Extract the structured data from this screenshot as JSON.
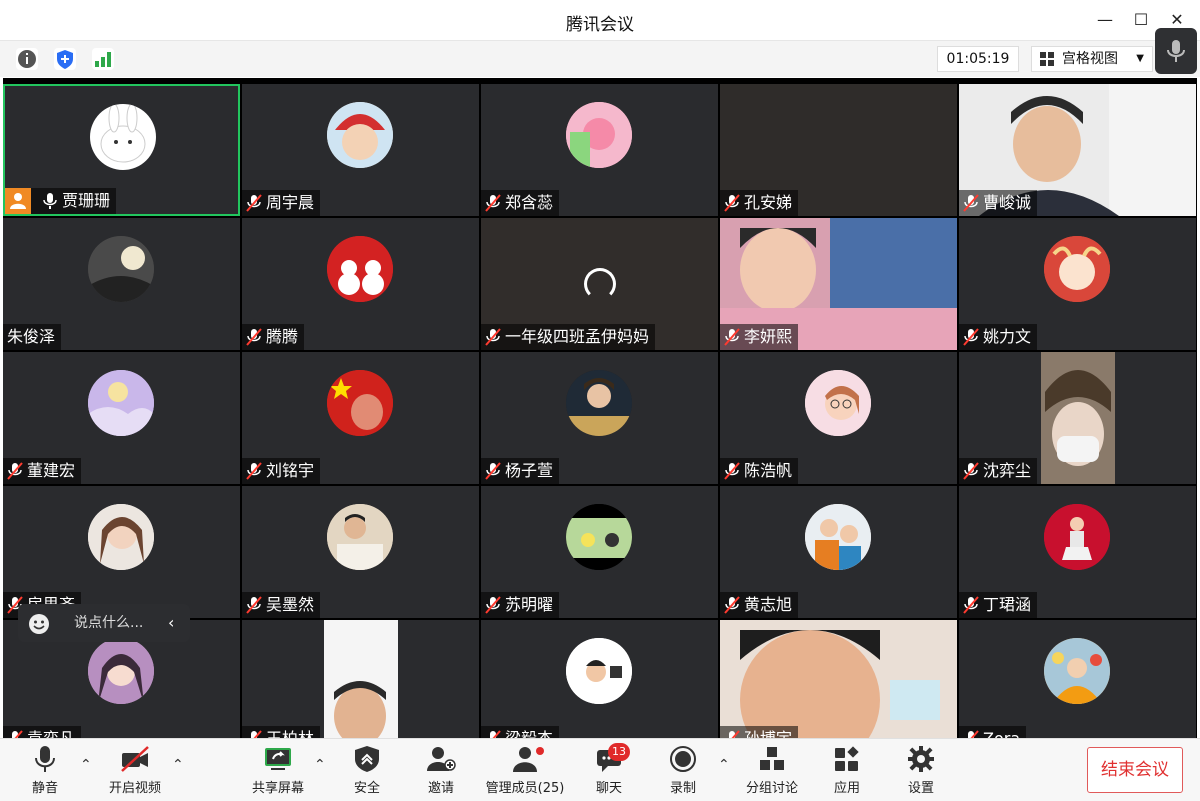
{
  "window": {
    "title": "腾讯会议"
  },
  "toolbar": {
    "timer": "01:05:19",
    "view_label": "宫格视图"
  },
  "tiles": [
    {
      "name": "贾珊珊"
    },
    {
      "name": "周宇晨"
    },
    {
      "name": "郑含蕊"
    },
    {
      "name": "孔安娣"
    },
    {
      "name": "曹峻诚"
    },
    {
      "name": "朱俊泽"
    },
    {
      "name": "腾腾"
    },
    {
      "name": "一年级四班孟伊妈妈"
    },
    {
      "name": "李妍熙"
    },
    {
      "name": "姚力文"
    },
    {
      "name": "董建宏"
    },
    {
      "name": "刘铭宇"
    },
    {
      "name": "杨子萱"
    },
    {
      "name": "陈浩帆"
    },
    {
      "name": "沈弈尘"
    },
    {
      "name": "房思齐"
    },
    {
      "name": "吴墨然"
    },
    {
      "name": "苏明曜"
    },
    {
      "name": "黄志旭"
    },
    {
      "name": "丁珺涵"
    },
    {
      "name": "袁奕凡"
    },
    {
      "name": "王柏林"
    },
    {
      "name": "梁毅杰"
    },
    {
      "name": "孙博宇"
    },
    {
      "name": "Zora"
    }
  ],
  "chat": {
    "placeholder": "说点什么..."
  },
  "bottom": {
    "mute": "静音",
    "video": "开启视频",
    "share": "共享屏幕",
    "security": "安全",
    "invite": "邀请",
    "members": "管理成员(25)",
    "chat": "聊天",
    "chat_badge": "13",
    "record": "录制",
    "breakout": "分组讨论",
    "apps": "应用",
    "settings": "设置",
    "end": "结束会议"
  },
  "colors": {
    "active_border": "#22c55e",
    "end_red": "#e03030",
    "tile_bg": "#2a2b2e",
    "badge_red": "#e02a2a"
  }
}
